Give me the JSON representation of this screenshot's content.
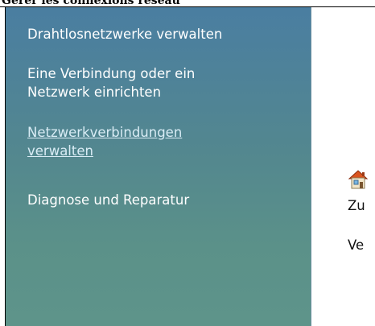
{
  "window": {
    "caption": "Gérer les connexions réseau"
  },
  "sidebar": {
    "tasks": [
      {
        "label": "Drahtlosnetzwerke verwalten",
        "link": false
      },
      {
        "label": "Eine Verbindung oder ein\nNetzwerk einrichten",
        "link": false
      },
      {
        "label": "Netzwerkverbindungen\nverwalten",
        "link": true
      },
      {
        "label": "Diagnose und Reparatur",
        "link": false
      }
    ]
  },
  "content": {
    "icon": "network-house-icon",
    "lines": [
      "Zu",
      "Ve"
    ]
  },
  "colors": {
    "sidebar_top": "#4a7ea1",
    "sidebar_bottom": "#5e948a",
    "task_text": "#ffffff",
    "link_text": "#d9ecf5"
  }
}
